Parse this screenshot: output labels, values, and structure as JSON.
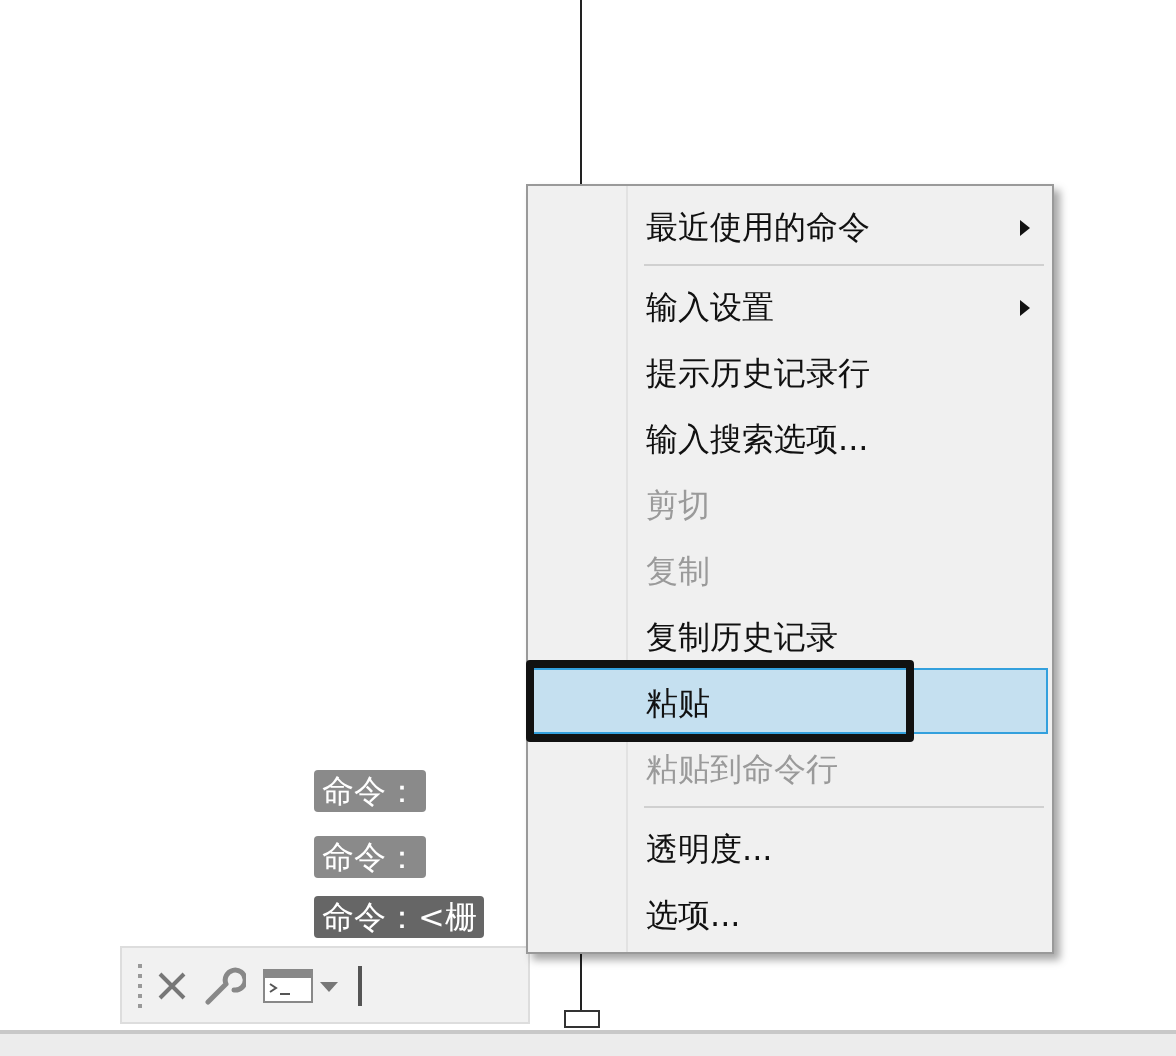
{
  "command_history": [
    {
      "text": "命令：",
      "kind": "past"
    },
    {
      "text": "命令：",
      "kind": "past"
    },
    {
      "text": "命令：<栅",
      "kind": "current"
    }
  ],
  "context_menu": {
    "items": [
      {
        "kind": "item",
        "label": "最近使用的命令",
        "submenu": true,
        "disabled": false,
        "selected": false,
        "annotated": false
      },
      {
        "kind": "separator"
      },
      {
        "kind": "item",
        "label": "输入设置",
        "submenu": true,
        "disabled": false,
        "selected": false,
        "annotated": false
      },
      {
        "kind": "item",
        "label": "提示历史记录行",
        "submenu": false,
        "disabled": false,
        "selected": false,
        "annotated": false
      },
      {
        "kind": "item",
        "label": "输入搜索选项...",
        "submenu": false,
        "disabled": false,
        "selected": false,
        "annotated": false
      },
      {
        "kind": "item",
        "label": "剪切",
        "submenu": false,
        "disabled": true,
        "selected": false,
        "annotated": false
      },
      {
        "kind": "item",
        "label": "复制",
        "submenu": false,
        "disabled": true,
        "selected": false,
        "annotated": false
      },
      {
        "kind": "item",
        "label": "复制历史记录",
        "submenu": false,
        "disabled": false,
        "selected": false,
        "annotated": false
      },
      {
        "kind": "item",
        "label": "粘贴",
        "submenu": false,
        "disabled": false,
        "selected": true,
        "annotated": true
      },
      {
        "kind": "item",
        "label": "粘贴到命令行",
        "submenu": false,
        "disabled": true,
        "selected": false,
        "annotated": false
      },
      {
        "kind": "separator"
      },
      {
        "kind": "item",
        "label": "透明度...",
        "submenu": false,
        "disabled": false,
        "selected": false,
        "annotated": false
      },
      {
        "kind": "item",
        "label": "选项...",
        "submenu": false,
        "disabled": false,
        "selected": false,
        "annotated": false
      }
    ]
  }
}
